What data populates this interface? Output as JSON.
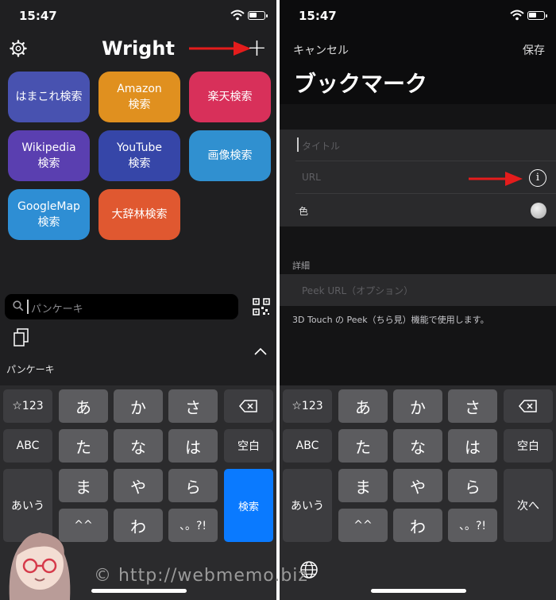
{
  "status": {
    "time": "15:47"
  },
  "left": {
    "title": "Wright",
    "tiles": [
      {
        "label": "はまこれ検索",
        "color": "#4852b0"
      },
      {
        "label": "Amazon\n検索",
        "color": "#e0901f"
      },
      {
        "label": "楽天検索",
        "color": "#d8305a"
      },
      {
        "label": "Wikipedia\n検索",
        "color": "#5a3fb0"
      },
      {
        "label": "YouTube\n検索",
        "color": "#3646a8"
      },
      {
        "label": "画像検索",
        "color": "#3090d0"
      },
      {
        "label": "GoogleMap\n検索",
        "color": "#2e8ed4"
      },
      {
        "label": "大辞林検索",
        "color": "#e05830"
      }
    ],
    "search_text": "パンケーキ",
    "suggestion": "パンケーキ",
    "keyboard": {
      "symbols": "☆123",
      "abc": "ABC",
      "aiu": "あいう",
      "rows": [
        [
          "あ",
          "か",
          "さ"
        ],
        [
          "た",
          "な",
          "は"
        ],
        [
          "ま",
          "や",
          "ら"
        ],
        [
          "^^",
          "わ",
          "、。?!"
        ]
      ],
      "space": "空白",
      "action": "検索"
    }
  },
  "right": {
    "cancel": "キャンセル",
    "save": "保存",
    "title": "ブックマーク",
    "field_title_placeholder": "タイトル",
    "field_url_placeholder": "URL",
    "field_color_label": "色",
    "section_label": "詳細",
    "peek_placeholder": "Peek URL（オプション）",
    "note": "3D Touch の Peek（ちら見）機能で使用します。",
    "keyboard": {
      "symbols": "☆123",
      "abc": "ABC",
      "aiu": "あいう",
      "rows": [
        [
          "あ",
          "か",
          "さ"
        ],
        [
          "た",
          "な",
          "は"
        ],
        [
          "ま",
          "や",
          "ら"
        ],
        [
          "^^",
          "わ",
          "、。?!"
        ]
      ],
      "space": "空白",
      "action": "次へ"
    }
  },
  "watermark": "© http://webmemo.biz",
  "icons": [
    "gear-icon",
    "plus-icon",
    "arrow-icon",
    "search-icon",
    "qr-code-icon",
    "document-icon",
    "chevron-up-icon",
    "delete-icon",
    "globe-icon",
    "info-icon",
    "wifi-icon",
    "battery-icon"
  ]
}
